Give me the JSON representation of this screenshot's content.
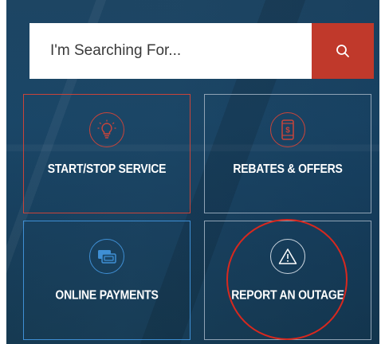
{
  "search": {
    "placeholder": "I'm Searching For...",
    "button_icon": "search-icon",
    "button_color": "#c0392b"
  },
  "tiles": [
    {
      "label": "START/STOP SERVICE",
      "icon": "lightbulb-icon",
      "border_color": "#c9443a"
    },
    {
      "label": "REBATES & OFFERS",
      "icon": "mobile-dollar-icon",
      "border_color": "#8fa3b5"
    },
    {
      "label": "ONLINE PAYMENTS",
      "icon": "payment-card-icon",
      "border_color": "#3f8fd4"
    },
    {
      "label": "REPORT AN OUTAGE",
      "icon": "warning-icon",
      "border_color": "#8fa3b5"
    }
  ],
  "annotation": {
    "type": "circle-highlight",
    "color": "#d9281e",
    "target": "REPORT AN OUTAGE"
  }
}
